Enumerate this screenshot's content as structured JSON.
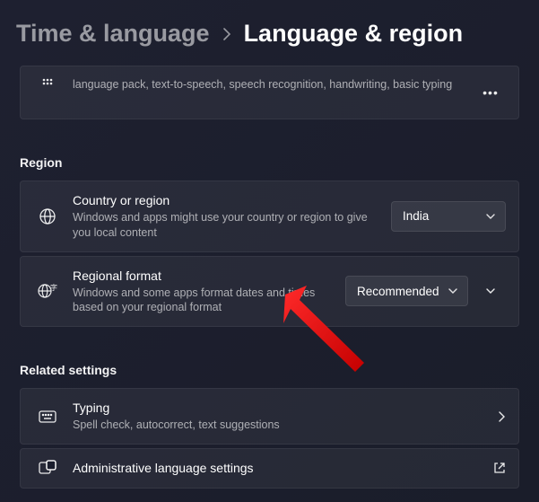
{
  "breadcrumb": {
    "parent": "Time & language",
    "current": "Language & region"
  },
  "lang_features": {
    "desc": "language pack, text-to-speech, speech recognition, handwriting, basic typing"
  },
  "sections": {
    "region": "Region",
    "related": "Related settings"
  },
  "region": {
    "country": {
      "title": "Country or region",
      "desc": "Windows and apps might use your country or region to give you local content",
      "value": "India"
    },
    "format": {
      "title": "Regional format",
      "desc": "Windows and some apps format dates and times based on your regional format",
      "value": "Recommended"
    }
  },
  "related": {
    "typing": {
      "title": "Typing",
      "desc": "Spell check, autocorrect, text suggestions"
    },
    "admin": {
      "title": "Administrative language settings"
    }
  }
}
